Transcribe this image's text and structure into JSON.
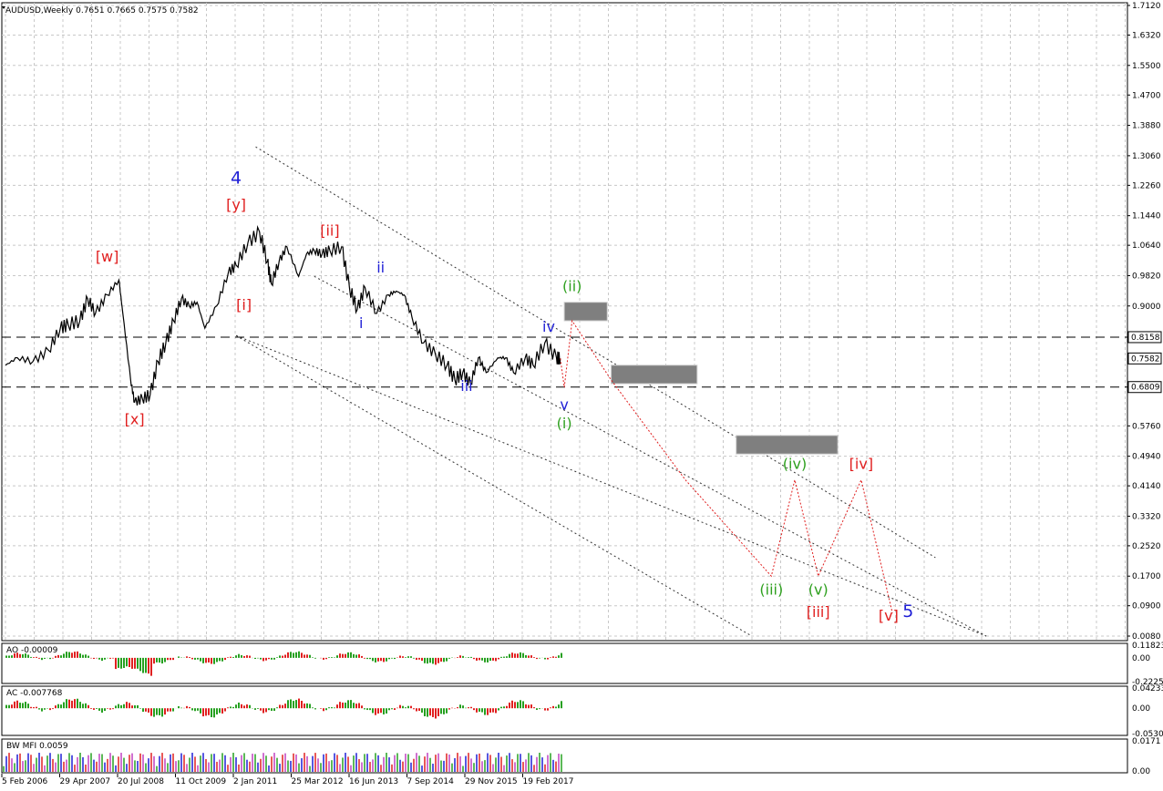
{
  "window": {
    "symbol_line": "AUDUSD,Weekly  0.7651 0.7665 0.7575 0.7582"
  },
  "chart_data": {
    "type": "line",
    "title": "AUDUSD,Weekly",
    "ohlc": {
      "open": 0.7651,
      "high": 0.7665,
      "low": 0.7575,
      "close": 0.7582
    },
    "ylim": [
      0.008,
      1.712
    ],
    "grid": true,
    "price_ticks": [
      "1.7120",
      "1.6320",
      "1.5500",
      "1.4700",
      "1.3880",
      "1.3060",
      "1.2260",
      "1.1440",
      "1.0640",
      "0.9820",
      "0.9000",
      "0.8158",
      "0.7582",
      "0.6809",
      "0.5760",
      "0.4940",
      "0.4140",
      "0.3320",
      "0.2520",
      "0.1700",
      "0.0900",
      "0.0080"
    ],
    "price_tags": [
      {
        "label": "0.8158",
        "value": 0.8158,
        "style": "dashed-level"
      },
      {
        "label": "0.7582",
        "value": 0.7582,
        "style": "current"
      },
      {
        "label": "0.6809",
        "value": 0.6809,
        "style": "dashed-level"
      }
    ],
    "date_ticks": [
      "5 Feb 2006",
      "29 Apr 2007",
      "20 Jul 2008",
      "11 Oct 2009",
      "2 Jan 2011",
      "25 Mar 2012",
      "16 Jun 2013",
      "7 Sep 2014",
      "29 Nov 2015",
      "19 Feb 2017"
    ],
    "price_series": [
      [
        "2006-02",
        0.74
      ],
      [
        "2006-05",
        0.76
      ],
      [
        "2006-09",
        0.75
      ],
      [
        "2007-01",
        0.78
      ],
      [
        "2007-04",
        0.84
      ],
      [
        "2007-06",
        0.85
      ],
      [
        "2007-09",
        0.86
      ],
      [
        "2007-11",
        0.92
      ],
      [
        "2008-01",
        0.88
      ],
      [
        "2008-04",
        0.93
      ],
      [
        "2008-07",
        0.97
      ],
      [
        "2008-08",
        0.88
      ],
      [
        "2008-10",
        0.7
      ],
      [
        "2008-11",
        0.64
      ],
      [
        "2009-01",
        0.65
      ],
      [
        "2009-03",
        0.66
      ],
      [
        "2009-05",
        0.75
      ],
      [
        "2009-07",
        0.8
      ],
      [
        "2009-09",
        0.86
      ],
      [
        "2009-11",
        0.92
      ],
      [
        "2010-01",
        0.9
      ],
      [
        "2010-03",
        0.91
      ],
      [
        "2010-05",
        0.84
      ],
      [
        "2010-08",
        0.9
      ],
      [
        "2010-11",
        0.99
      ],
      [
        "2011-01",
        1.01
      ],
      [
        "2011-04",
        1.07
      ],
      [
        "2011-07",
        1.1
      ],
      [
        "2011-09",
        1.02
      ],
      [
        "2011-10",
        0.96
      ],
      [
        "2011-12",
        1.02
      ],
      [
        "2012-02",
        1.06
      ],
      [
        "2012-05",
        0.98
      ],
      [
        "2012-07",
        1.04
      ],
      [
        "2012-09",
        1.05
      ],
      [
        "2012-11",
        1.04
      ],
      [
        "2013-01",
        1.05
      ],
      [
        "2013-04",
        1.06
      ],
      [
        "2013-06",
        0.95
      ],
      [
        "2013-08",
        0.89
      ],
      [
        "2013-10",
        0.95
      ],
      [
        "2014-01",
        0.88
      ],
      [
        "2014-04",
        0.93
      ],
      [
        "2014-06",
        0.94
      ],
      [
        "2014-08",
        0.93
      ],
      [
        "2014-10",
        0.87
      ],
      [
        "2015-01",
        0.8
      ],
      [
        "2015-04",
        0.77
      ],
      [
        "2015-07",
        0.74
      ],
      [
        "2015-09",
        0.7
      ],
      [
        "2015-11",
        0.72
      ],
      [
        "2016-01",
        0.69
      ],
      [
        "2016-03",
        0.76
      ],
      [
        "2016-05",
        0.72
      ],
      [
        "2016-08",
        0.76
      ],
      [
        "2016-10",
        0.76
      ],
      [
        "2016-12",
        0.72
      ],
      [
        "2017-03",
        0.76
      ],
      [
        "2017-05",
        0.74
      ],
      [
        "2017-08",
        0.8
      ],
      [
        "2017-11",
        0.76
      ],
      [
        "2017-12",
        0.7582
      ]
    ],
    "forecast_path": [
      [
        "2017-12",
        0.7582
      ],
      [
        "2018-01",
        0.68
      ],
      [
        "2018-03",
        0.86
      ],
      [
        "2019-01",
        0.7
      ],
      [
        "2020-08",
        0.43
      ],
      [
        "2022-06",
        0.17
      ],
      [
        "2022-12",
        0.43
      ],
      [
        "2023-06",
        0.17
      ],
      [
        "2024-05",
        0.43
      ],
      [
        "2025-01",
        0.07
      ]
    ],
    "zones": [
      {
        "from": "2018-01",
        "to": "2018-12",
        "top": 0.91,
        "bottom": 0.86
      },
      {
        "from": "2019-01",
        "to": "2020-11",
        "top": 0.74,
        "bottom": 0.69
      },
      {
        "from": "2021-09",
        "to": "2023-11",
        "top": 0.55,
        "bottom": 0.5
      }
    ],
    "annotations": [
      {
        "text": "4",
        "date": "2011-01",
        "value": 1.23,
        "color": "#1f1fd6",
        "size": "large"
      },
      {
        "text": "[y]",
        "date": "2011-01",
        "value": 1.16,
        "color": "#e01e1e"
      },
      {
        "text": "[w]",
        "date": "2008-04",
        "value": 1.02,
        "color": "#e01e1e"
      },
      {
        "text": "[ii]",
        "date": "2013-01",
        "value": 1.09,
        "color": "#e01e1e"
      },
      {
        "text": "ii",
        "date": "2014-02",
        "value": 0.99,
        "color": "#1f1fd6"
      },
      {
        "text": "[i]",
        "date": "2011-03",
        "value": 0.89,
        "color": "#e01e1e"
      },
      {
        "text": "i",
        "date": "2013-09",
        "value": 0.84,
        "color": "#1f1fd6"
      },
      {
        "text": "[x]",
        "date": "2008-11",
        "value": 0.58,
        "color": "#e01e1e"
      },
      {
        "text": "iii",
        "date": "2015-12",
        "value": 0.67,
        "color": "#1f1fd6"
      },
      {
        "text": "iv",
        "date": "2017-09",
        "value": 0.83,
        "color": "#1f1fd6"
      },
      {
        "text": "v",
        "date": "2018-01",
        "value": 0.62,
        "color": "#1f1fd6"
      },
      {
        "text": "(i)",
        "date": "2018-01",
        "value": 0.57,
        "color": "#2ea01e"
      },
      {
        "text": "(ii)",
        "date": "2018-03",
        "value": 0.94,
        "color": "#2ea01e"
      },
      {
        "text": "(iv)",
        "date": "2022-12",
        "value": 0.46,
        "color": "#2ea01e"
      },
      {
        "text": "(iii)",
        "date": "2022-06",
        "value": 0.12,
        "color": "#2ea01e"
      },
      {
        "text": "(v)",
        "date": "2023-06",
        "value": 0.12,
        "color": "#2ea01e"
      },
      {
        "text": "[iii]",
        "date": "2023-06",
        "value": 0.06,
        "color": "#e01e1e"
      },
      {
        "text": "[iv]",
        "date": "2024-05",
        "value": 0.46,
        "color": "#e01e1e"
      },
      {
        "text": "[v]",
        "date": "2024-12",
        "value": 0.05,
        "color": "#e01e1e"
      },
      {
        "text": "5",
        "date": "2025-05",
        "value": 0.06,
        "color": "#1f1fd6",
        "size": "large"
      }
    ],
    "indicators": [
      {
        "name": "AO",
        "title": "AO -0.00009",
        "ticks": [
          "0.11823",
          "0.00",
          "-0.22254"
        ],
        "ylim": [
          -0.22254,
          0.11823
        ]
      },
      {
        "name": "AC",
        "title": "AC -0.007768",
        "ticks": [
          "0.042338",
          "0.00",
          "-0.053028"
        ],
        "ylim": [
          -0.053028,
          0.042338
        ]
      },
      {
        "name": "BW MFI",
        "title": "BW MFI 0.0059",
        "ticks": [
          "0.0171",
          "0.00"
        ],
        "ylim": [
          0,
          0.0171
        ]
      }
    ],
    "colors": {
      "up": "#26a020",
      "down": "#e02020",
      "price": "#000000",
      "forecast": "#e01e1e",
      "zone": "#7f7f7f"
    }
  }
}
